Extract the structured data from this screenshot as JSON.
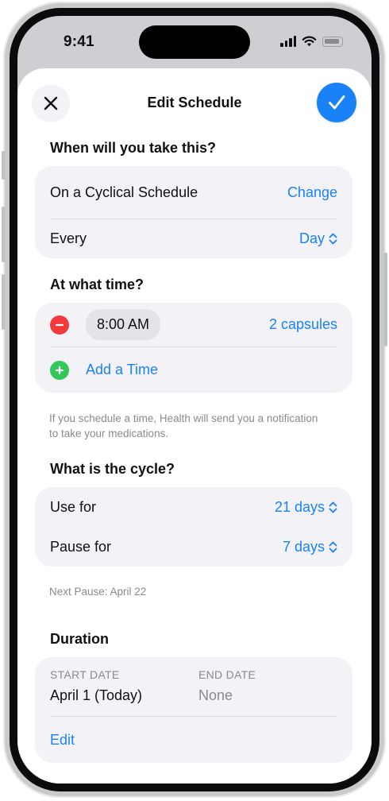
{
  "status_bar": {
    "time": "9:41"
  },
  "header": {
    "title": "Edit Schedule"
  },
  "when": {
    "title": "When will you take this?",
    "schedule_label": "On a Cyclical Schedule",
    "change_label": "Change",
    "every_label": "Every",
    "every_value": "Day"
  },
  "time_section": {
    "title": "At what time?",
    "time_value": "8:00 AM",
    "dose": "2 capsules",
    "add_label": "Add a Time",
    "footnote": "If you schedule a time, Health will send you a notification to take your medications."
  },
  "cycle": {
    "title": "What is the cycle?",
    "use_label": "Use for",
    "use_value": "21 days",
    "pause_label": "Pause for",
    "pause_value": "7 days",
    "footnote": "Next Pause: April 22"
  },
  "duration": {
    "title": "Duration",
    "start_label": "START DATE",
    "start_value": "April 1 (Today)",
    "end_label": "END DATE",
    "end_value": "None",
    "edit_label": "Edit"
  },
  "colors": {
    "accent": "#1a82f7",
    "remove": "#f23a3a",
    "add": "#34c759",
    "card": "#f2f2f7",
    "secondary_text": "#8a8a8e"
  }
}
